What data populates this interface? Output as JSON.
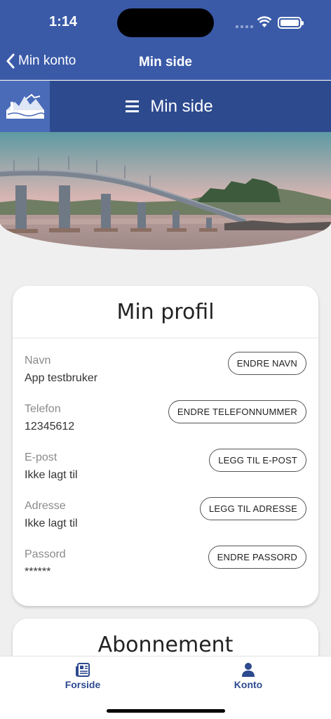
{
  "status": {
    "time": "1:14"
  },
  "nav": {
    "back_label": "Min konto",
    "title": "Min side"
  },
  "site": {
    "menu_label": "Min side"
  },
  "profile": {
    "title": "Min profil",
    "rows": [
      {
        "label": "Navn",
        "value": "App testbruker",
        "button": "ENDRE NAVN"
      },
      {
        "label": "Telefon",
        "value": "12345612",
        "button": "ENDRE TELEFONNUMMER"
      },
      {
        "label": "E-post",
        "value": "Ikke lagt til",
        "button": "LEGG TIL E-POST"
      },
      {
        "label": "Adresse",
        "value": "Ikke lagt til",
        "button": "LEGG TIL ADRESSE"
      },
      {
        "label": "Passord",
        "value": "******",
        "button": "ENDRE PASSORD"
      }
    ]
  },
  "subscription": {
    "title": "Abonnement"
  },
  "tabs": [
    {
      "label": "Forside",
      "icon": "newspaper-icon"
    },
    {
      "label": "Konto",
      "icon": "person-icon"
    }
  ],
  "colors": {
    "brand": "#3a5aa8",
    "brand_dark": "#2d4a8f"
  }
}
